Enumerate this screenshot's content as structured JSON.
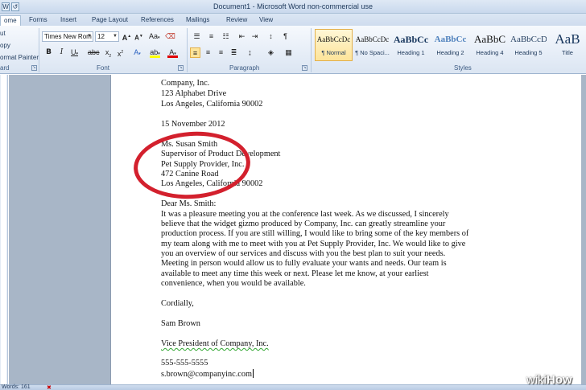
{
  "window": {
    "title": "Document1 - Microsoft Word non-commercial use"
  },
  "quick_access": {
    "word_icon": "W",
    "undo_icon": "↺"
  },
  "tabs": [
    "ome",
    "Forms",
    "Insert",
    "Page Layout",
    "References",
    "Mailings",
    "Review",
    "View"
  ],
  "clipboard": {
    "cut": "ut",
    "copy": "opy",
    "format_painter": "ormat Painter",
    "label": "ard"
  },
  "font": {
    "name": "Times New Rom",
    "size": "12",
    "label": "Font"
  },
  "paragraph": {
    "label": "Paragraph"
  },
  "styles": {
    "label": "Styles",
    "items": [
      {
        "sample": "AaBbCcDc",
        "name": "¶ Normal"
      },
      {
        "sample": "AaBbCcDc",
        "name": "¶ No Spaci..."
      },
      {
        "sample": "AaBbCc",
        "name": "Heading 1"
      },
      {
        "sample": "AaBbCc",
        "name": "Heading 2"
      },
      {
        "sample": "AaBbC",
        "name": "Heading 4"
      },
      {
        "sample": "AaBbCcD",
        "name": "Heading 5"
      },
      {
        "sample": "AaB",
        "name": "Title"
      }
    ]
  },
  "document": {
    "lines": [
      "Company, Inc.",
      "123 Alphabet Drive",
      "Los Angeles, California 90002",
      "15 November 2012",
      "Ms. Susan Smith",
      "Supervisor of Product Development",
      "Pet Supply Provider, Inc.",
      "472 Canine Road",
      "Los Angeles, California 90002",
      "Dear Ms. Smith:",
      "It was a pleasure meeting you at the conference last week. As we discussed, I sincerely",
      "believe that the widget gizmo produced by Company, Inc. can greatly streamline  your",
      "production process. If you are still willing, I would like to bring some of the key members  of",
      "my team along with me to meet with you at Pet Supply Provider, Inc. We would like to give",
      "you an overview of our services  and discuss with you the best plan to suit your needs.",
      "Meeting in person would allow us to fully evaluate your wants and needs. Our team is",
      "available to meet any time this week or next. Please let me know, at your earliest",
      "convenience, when you would be available.",
      "Cordially,",
      "Sam Brown",
      "Vice President of Company, Inc.",
      "555-555-5555",
      "s.brown@companyinc.com"
    ]
  },
  "status": {
    "words": "Words: 161"
  },
  "watermark": {
    "part1": "wiki",
    "part2": "How"
  },
  "colors": {
    "annotation_circle": "#d3202d",
    "spellcheck": "#2fa52f"
  }
}
